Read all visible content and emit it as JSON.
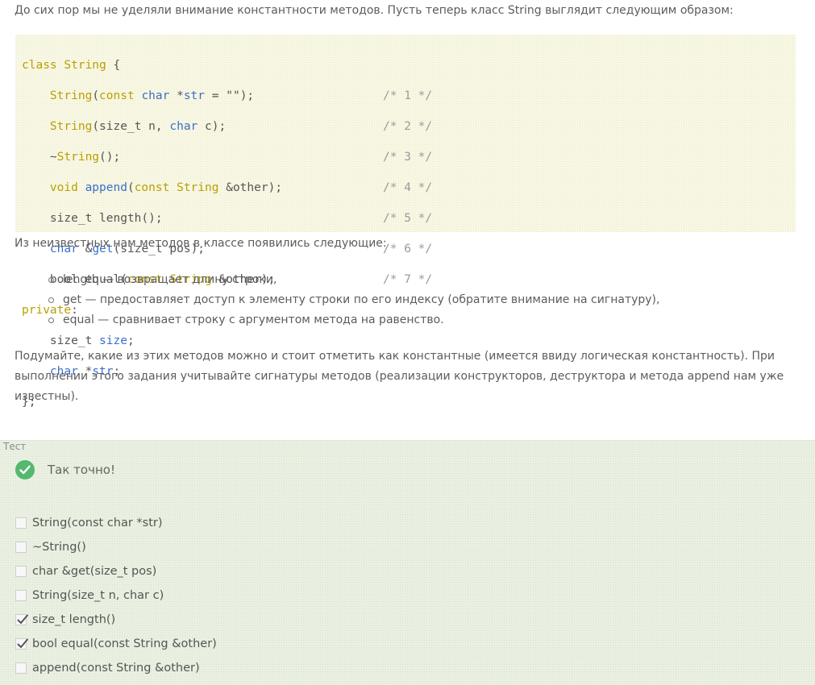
{
  "intro": "До сих пор мы не уделяли внимание константности методов. Пусть теперь класс String выглядит следующим образом:",
  "code": {
    "l1": [
      "class",
      "String",
      "{"
    ],
    "l2": [
      "String",
      "const",
      "char",
      "str",
      "\"\"",
      "/* 1 */"
    ],
    "l3": [
      "String",
      "size_t n",
      "char",
      "c",
      "/* 2 */"
    ],
    "l4": [
      "~",
      "String",
      "/* 3 */"
    ],
    "l5": [
      "void",
      "append",
      "const",
      "String",
      "&other",
      "/* 4 */"
    ],
    "l6": [
      "size_t length",
      "/* 5 */"
    ],
    "l7": [
      "char",
      "get",
      "size_t pos",
      "/* 6 */"
    ],
    "l8": [
      "bool equal",
      "const",
      "String",
      "&other",
      "/* 7 */"
    ],
    "private": "private",
    "l10": [
      "size_t",
      "size"
    ],
    "l11": [
      "char",
      "str"
    ],
    "end": "};"
  },
  "after_code": "Из неизвестных нам методов в классе появились следующие:",
  "methods": [
    "length — возвращает длину строки,",
    "get — предоставляет доступ к элементу строки по его индексу (обратите внимание на сигнатуру),",
    "equal — сравнивает строку с аргументом метода на равенство."
  ],
  "task": "Подумайте, какие из этих методов можно и стоит отметить как константные (имеется ввиду логическая константность). При выполнении этого задания учитывайте сигнатуры методов (реализации конструкторов, деструктора и метода append нам уже известны).",
  "quiz": {
    "label": "Тест",
    "result": "Так точно!",
    "success_color": "#54b86f",
    "options": [
      {
        "label": "String(const char *str)",
        "checked": false
      },
      {
        "label": "~String()",
        "checked": false
      },
      {
        "label": "char &get(size_t pos)",
        "checked": false
      },
      {
        "label": "String(size_t n, char c)",
        "checked": false
      },
      {
        "label": "size_t length()",
        "checked": true
      },
      {
        "label": "bool equal(const String &other)",
        "checked": true
      },
      {
        "label": "append(const String &other)",
        "checked": false
      }
    ]
  }
}
